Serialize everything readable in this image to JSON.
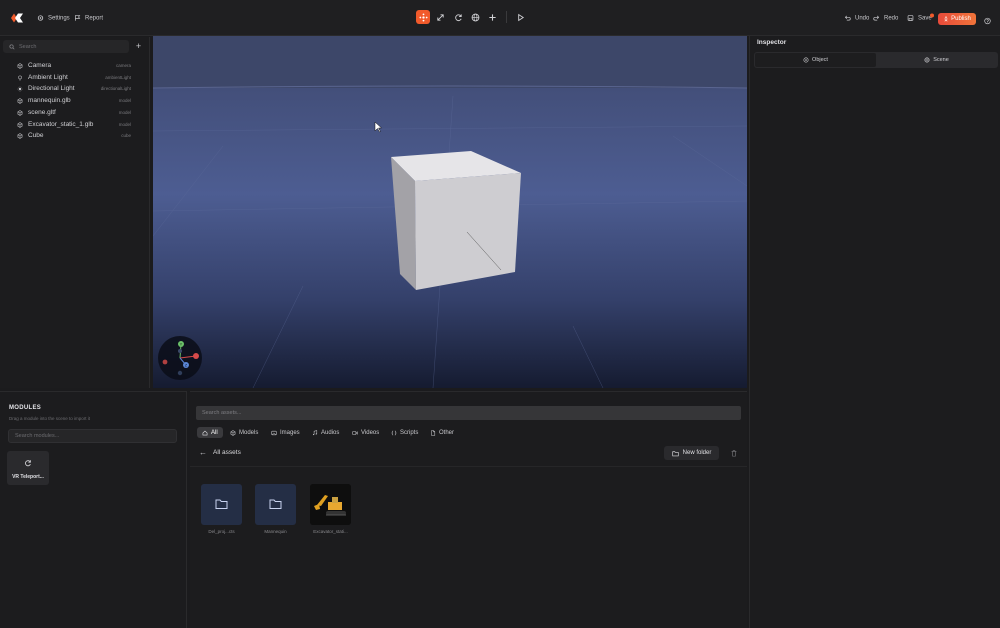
{
  "topbar": {
    "settings_label": "Settings",
    "report_label": "Report",
    "undo_label": "Undo",
    "redo_label": "Redo",
    "save_label": "Save",
    "publish_label": "Publish"
  },
  "hierarchy": {
    "search_placeholder": "Search",
    "add_label": "+",
    "items": [
      {
        "name": "Camera",
        "type": "camera",
        "icon": "cube-icon"
      },
      {
        "name": "Ambient Light",
        "type": "ambientLight",
        "icon": "light-bulb-icon"
      },
      {
        "name": "Directional Light",
        "type": "directionalLight",
        "icon": "sun-icon"
      },
      {
        "name": "mannequin.glb",
        "type": "model",
        "icon": "cube-icon"
      },
      {
        "name": "scene.gltf",
        "type": "model",
        "icon": "cube-icon"
      },
      {
        "name": "Excavator_static_1.glb",
        "type": "model",
        "icon": "cube-icon"
      },
      {
        "name": "Cube",
        "type": "cube",
        "icon": "cube-icon"
      }
    ]
  },
  "inspector": {
    "title": "Inspector",
    "tabs": [
      {
        "label": "Object",
        "active": true
      },
      {
        "label": "Scene",
        "active": false
      }
    ]
  },
  "gizmo": {
    "y_label": "Y",
    "z_label": "Z"
  },
  "modules": {
    "title": "MODULES",
    "subtitle": "Drag a module into the scene to import it",
    "search_placeholder": "Search modules...",
    "cards": [
      {
        "label": "VR Teleport...",
        "icon": "refresh-icon"
      }
    ]
  },
  "assets": {
    "search_placeholder": "Search assets...",
    "filters": [
      {
        "label": "All",
        "icon": "home-icon",
        "active": true
      },
      {
        "label": "Models",
        "icon": "cube-icon",
        "active": false
      },
      {
        "label": "Images",
        "icon": "image-icon",
        "active": false
      },
      {
        "label": "Audios",
        "icon": "music-icon",
        "active": false
      },
      {
        "label": "Videos",
        "icon": "video-icon",
        "active": false
      },
      {
        "label": "Scripts",
        "icon": "braces-icon",
        "active": false
      },
      {
        "label": "Other",
        "icon": "file-icon",
        "active": false
      }
    ],
    "path": "All assets",
    "new_folder_label": "New folder",
    "items": [
      {
        "label": "Del_proj...cts",
        "kind": "folder"
      },
      {
        "label": "Mannequin",
        "kind": "folder"
      },
      {
        "label": "Excavator_stati...",
        "kind": "model"
      }
    ]
  },
  "colors": {
    "accent": "#f15a2b",
    "panel": "#1c1c1e",
    "folder_tile": "#242e45"
  }
}
